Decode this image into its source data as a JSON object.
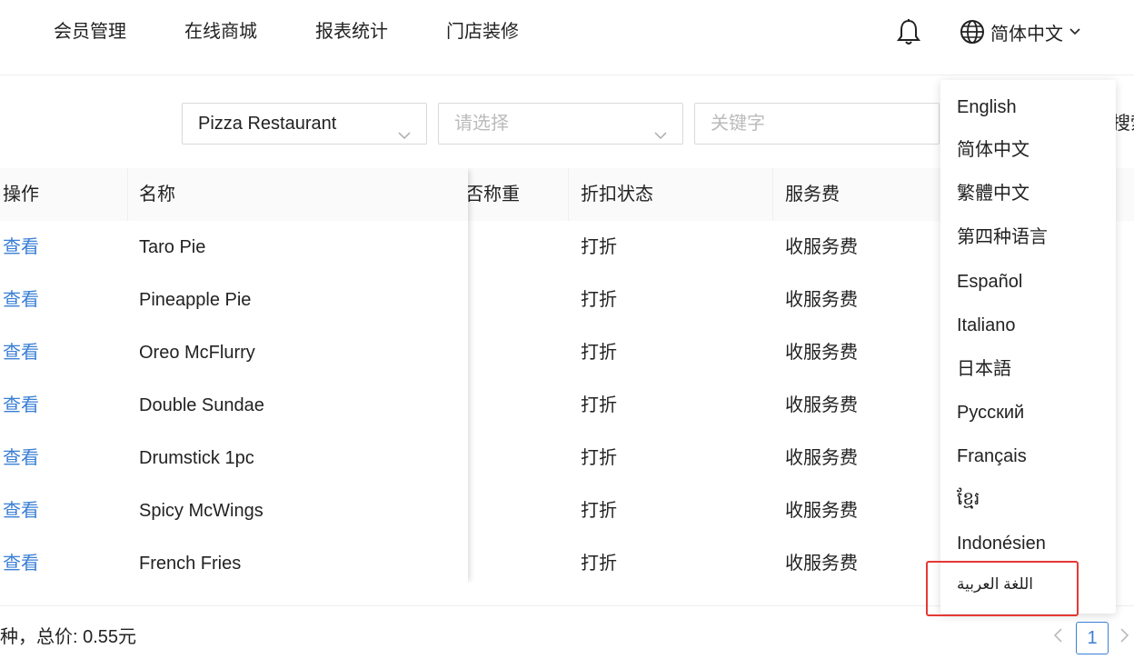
{
  "nav": {
    "items": [
      "会员管理",
      "在线商城",
      "报表统计",
      "门店装修"
    ],
    "language_label": "简体中文"
  },
  "filters": {
    "store_value": "Pizza Restaurant",
    "category_placeholder": "请选择",
    "keyword_placeholder": "关键字",
    "search_label_partial": "搜索"
  },
  "table": {
    "headers": {
      "action": "操作",
      "name": "名称",
      "weigh_partial": "否称重",
      "discount": "折扣状态",
      "service": "服务费"
    },
    "rows": [
      {
        "action": "查看",
        "name": "Taro Pie",
        "discount": "打折",
        "service": "收服务费"
      },
      {
        "action": "查看",
        "name": "Pineapple Pie",
        "discount": "打折",
        "service": "收服务费"
      },
      {
        "action": "查看",
        "name": "Oreo McFlurry",
        "discount": "打折",
        "service": "收服务费"
      },
      {
        "action": "查看",
        "name": "Double Sundae",
        "discount": "打折",
        "service": "收服务费"
      },
      {
        "action": "查看",
        "name": "Drumstick 1pc",
        "discount": "打折",
        "service": "收服务费"
      },
      {
        "action": "查看",
        "name": "Spicy McWings",
        "discount": "打折",
        "service": "收服务费"
      },
      {
        "action": "查看",
        "name": "French Fries",
        "discount": "打折",
        "service": "收服务费"
      }
    ]
  },
  "footer": {
    "summary": "种，总价: 0.55元",
    "current_page": "1"
  },
  "language_menu": {
    "items": [
      "English",
      "简体中文",
      "繁體中文",
      "第四种语言",
      "Español",
      "Italiano",
      "日本語",
      "Русский",
      "Français",
      "ខ្មែរ",
      "Indonésien",
      "اللغة العربية"
    ]
  },
  "colors": {
    "link": "#3a7fd5",
    "highlight": "#e53935"
  }
}
